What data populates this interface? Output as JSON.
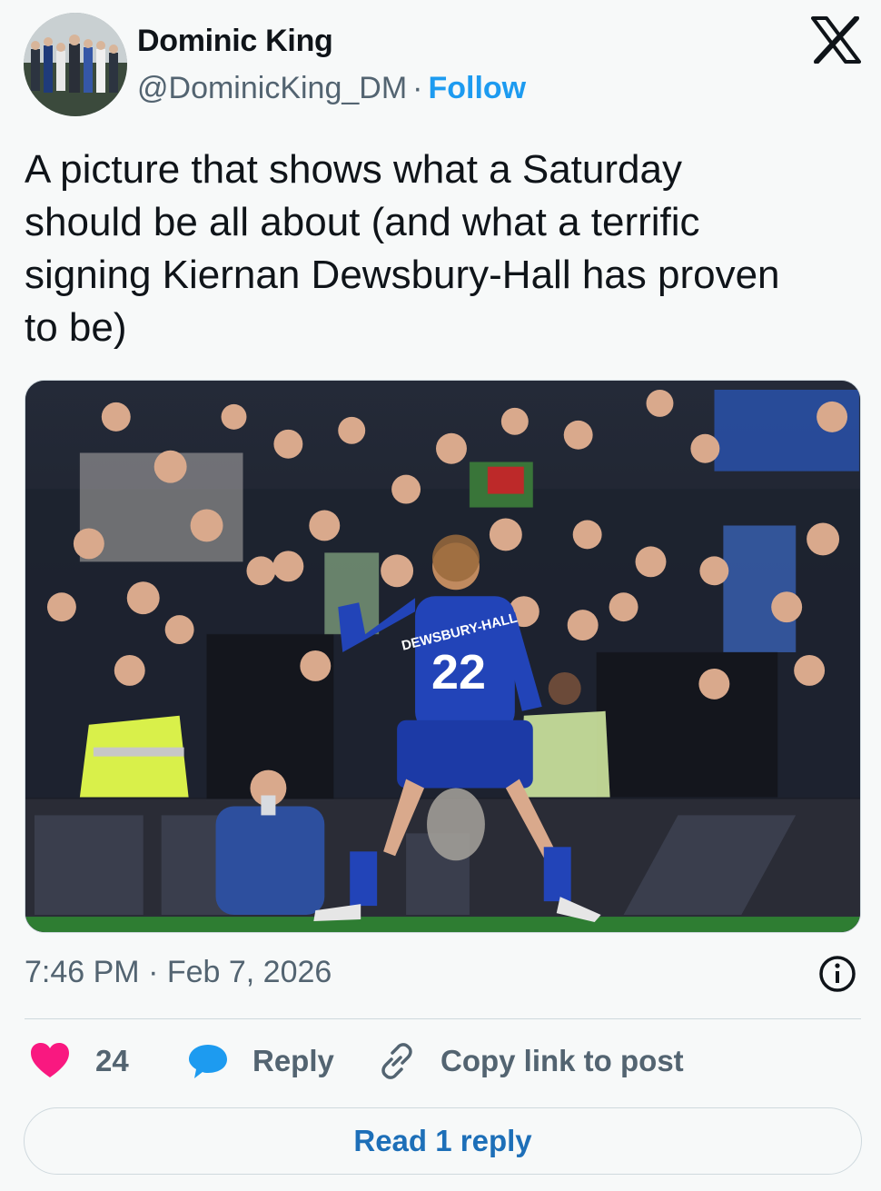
{
  "author": {
    "display_name": "Dominic King",
    "handle": "@DominicKing_DM",
    "separator": "·",
    "follow_label": "Follow"
  },
  "tweet": {
    "text": "A picture that shows what a Saturday\nshould be all about (and what a terrific\nsigning Kiernan Dewsbury-Hall has proven\nto be)"
  },
  "media": {
    "jersey_name": "DEWSBURY-HALL",
    "jersey_number": "22"
  },
  "timestamp": "7:46 PM · Feb 7, 2026",
  "actions": {
    "like_count": "24",
    "reply_label": "Reply",
    "copy_link_label": "Copy link to post"
  },
  "read_replies_label": "Read 1 reply",
  "colors": {
    "accent": "#1d9bf0",
    "like": "#f91880",
    "text_secondary": "#536471",
    "border": "#cfd9de"
  },
  "icons": [
    "x-logo-icon",
    "info-icon",
    "heart-icon",
    "reply-bubble-icon",
    "link-icon"
  ]
}
